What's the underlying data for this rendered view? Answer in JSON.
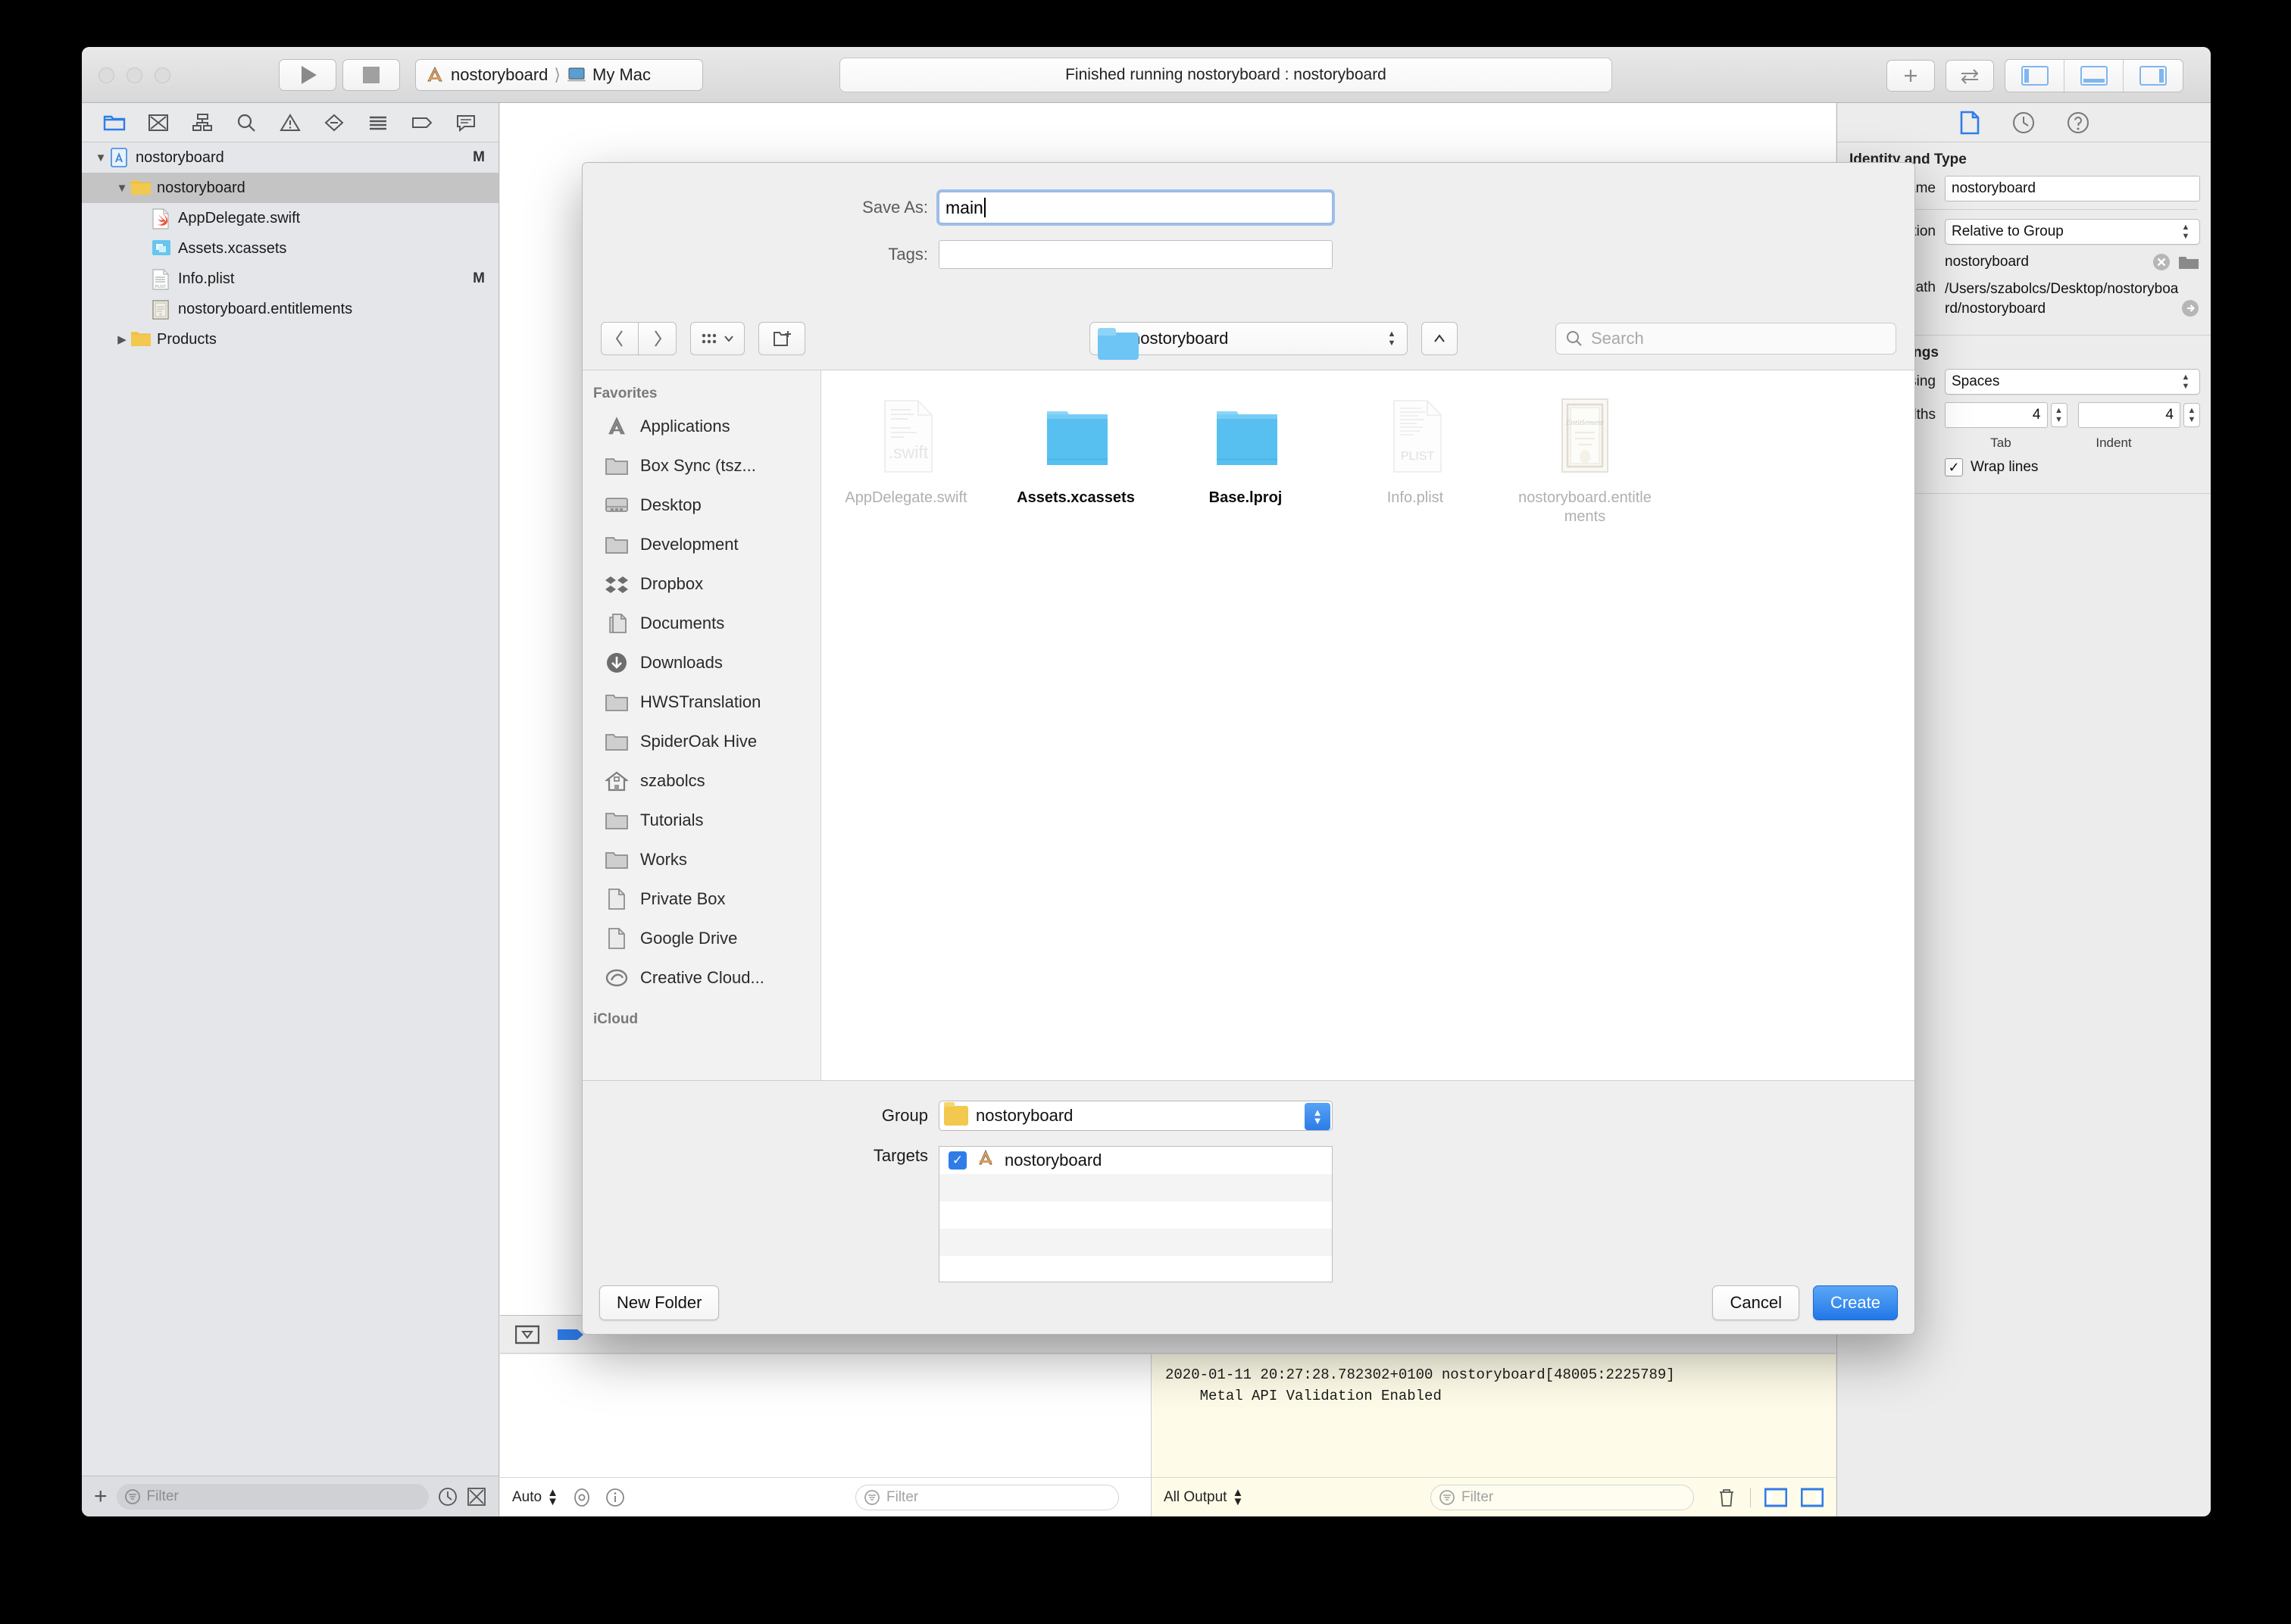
{
  "window": {
    "toolbar": {
      "scheme_project": "nostoryboard",
      "scheme_device": "My Mac",
      "status_text": "Finished running nostoryboard : nostoryboard",
      "play_icon": "play-icon",
      "stop_icon": "stop-icon",
      "add_icon": "plus-icon",
      "swap_icon": "swap-arrows-icon"
    }
  },
  "navigator": {
    "icons": [
      "folder-icon",
      "source-control-icon",
      "symbol-icon",
      "find-icon",
      "issue-warning-icon",
      "test-icon",
      "debug-icon",
      "breakpoint-icon",
      "report-icon"
    ],
    "tree": [
      {
        "label": "nostoryboard",
        "indent": 0,
        "disclosure": "open",
        "icon": "xcode-project-icon",
        "status": "M",
        "selected": false
      },
      {
        "label": "nostoryboard",
        "indent": 1,
        "disclosure": "open",
        "icon": "folder-yellow-icon",
        "status": "",
        "selected": true
      },
      {
        "label": "AppDelegate.swift",
        "indent": 2,
        "disclosure": "none",
        "icon": "swift-file-icon",
        "status": "",
        "selected": false
      },
      {
        "label": "Assets.xcassets",
        "indent": 2,
        "disclosure": "none",
        "icon": "assets-catalog-icon",
        "status": "",
        "selected": false
      },
      {
        "label": "Info.plist",
        "indent": 2,
        "disclosure": "none",
        "icon": "plist-file-icon",
        "status": "M",
        "selected": false
      },
      {
        "label": "nostoryboard.entitlements",
        "indent": 2,
        "disclosure": "none",
        "icon": "entitlements-file-icon",
        "status": "",
        "selected": false
      },
      {
        "label": "Products",
        "indent": 1,
        "disclosure": "closed",
        "icon": "folder-yellow-icon",
        "status": "",
        "selected": false
      }
    ],
    "filter_placeholder": "Filter",
    "add_label": "+"
  },
  "save_dialog": {
    "save_as_label": "Save As:",
    "save_as_value": "main",
    "tags_label": "Tags:",
    "tags_value": "",
    "path_popup_value": "nostoryboard",
    "search_placeholder": "Search",
    "back_icon": "chevron-left-icon",
    "forward_icon": "chevron-right-icon",
    "view_mode_icon": "icon-view-icon",
    "new_folder_icon": "new-folder-icon",
    "up_icon": "chevron-up-icon",
    "sidebar": {
      "favorites_header": "Favorites",
      "icloud_header": "iCloud",
      "items": [
        {
          "label": "Applications",
          "icon": "applications-icon"
        },
        {
          "label": "Box Sync (tsz...",
          "icon": "folder-icon"
        },
        {
          "label": "Desktop",
          "icon": "desktop-icon"
        },
        {
          "label": "Development",
          "icon": "folder-icon"
        },
        {
          "label": "Dropbox",
          "icon": "dropbox-icon"
        },
        {
          "label": "Documents",
          "icon": "documents-icon"
        },
        {
          "label": "Downloads",
          "icon": "downloads-icon"
        },
        {
          "label": "HWSTranslation",
          "icon": "folder-icon"
        },
        {
          "label": "SpiderOak Hive",
          "icon": "folder-icon"
        },
        {
          "label": "szabolcs",
          "icon": "home-icon"
        },
        {
          "label": "Tutorials",
          "icon": "folder-icon"
        },
        {
          "label": "Works",
          "icon": "folder-icon"
        },
        {
          "label": "Private Box",
          "icon": "document-icon"
        },
        {
          "label": "Google Drive",
          "icon": "document-icon"
        },
        {
          "label": "Creative Cloud...",
          "icon": "creative-cloud-icon"
        }
      ]
    },
    "files": [
      {
        "name": "AppDelegate.swift",
        "icon": "swift-file-icon",
        "enabled": false
      },
      {
        "name": "Assets.xcassets",
        "icon": "folder-blue-icon",
        "enabled": true
      },
      {
        "name": "Base.lproj",
        "icon": "folder-blue-icon",
        "enabled": true
      },
      {
        "name": "Info.plist",
        "icon": "plist-file-icon",
        "enabled": false
      },
      {
        "name": "nostoryboard.entitlements",
        "icon": "entitlements-file-icon",
        "enabled": false
      }
    ],
    "group_label": "Group",
    "group_value": "nostoryboard",
    "targets_label": "Targets",
    "targets": [
      {
        "name": "nostoryboard",
        "checked": true,
        "icon": "xcode-target-icon"
      }
    ],
    "new_folder_button": "New Folder",
    "cancel_button": "Cancel",
    "create_button": "Create"
  },
  "inspector": {
    "tabs": [
      "file-inspector-icon",
      "history-inspector-icon",
      "quick-help-icon"
    ],
    "identity_section_title": "Identity and Type",
    "name_label": "Name",
    "name_value": "nostoryboard",
    "location_label": "Location",
    "location_value": "Relative to Group",
    "location_file": "nostoryboard",
    "full_path_label": "Full Path",
    "full_path_value": "/Users/szabolcs/Desktop/nostoryboard/nostoryboard",
    "text_section_title": "Text Settings",
    "indent_using_label": "Indent Using",
    "indent_using_value": "Spaces",
    "widths_label": "Widths",
    "tab_width": "4",
    "indent_width": "4",
    "tab_caption": "Tab",
    "indent_caption": "Indent",
    "wrap_lines_label": "Wrap lines",
    "wrap_lines_checked": true
  },
  "debug_area": {
    "variables_scope": "Auto",
    "variables_filter_placeholder": "Filter",
    "console_scope": "All Output",
    "console_filter_placeholder": "Filter",
    "console_lines": [
      "2020-01-11 20:27:28.782302+0100 nostoryboard[48005:2225789]",
      "    Metal API Validation Enabled"
    ],
    "trash_icon": "trash-icon"
  },
  "colors": {
    "accent_blue": "#2f7ce9",
    "folder_blue": "#6cc5f5",
    "folder_yellow": "#f3c84e",
    "console_bg": "#fefce8",
    "window_chrome": "#ececec"
  }
}
